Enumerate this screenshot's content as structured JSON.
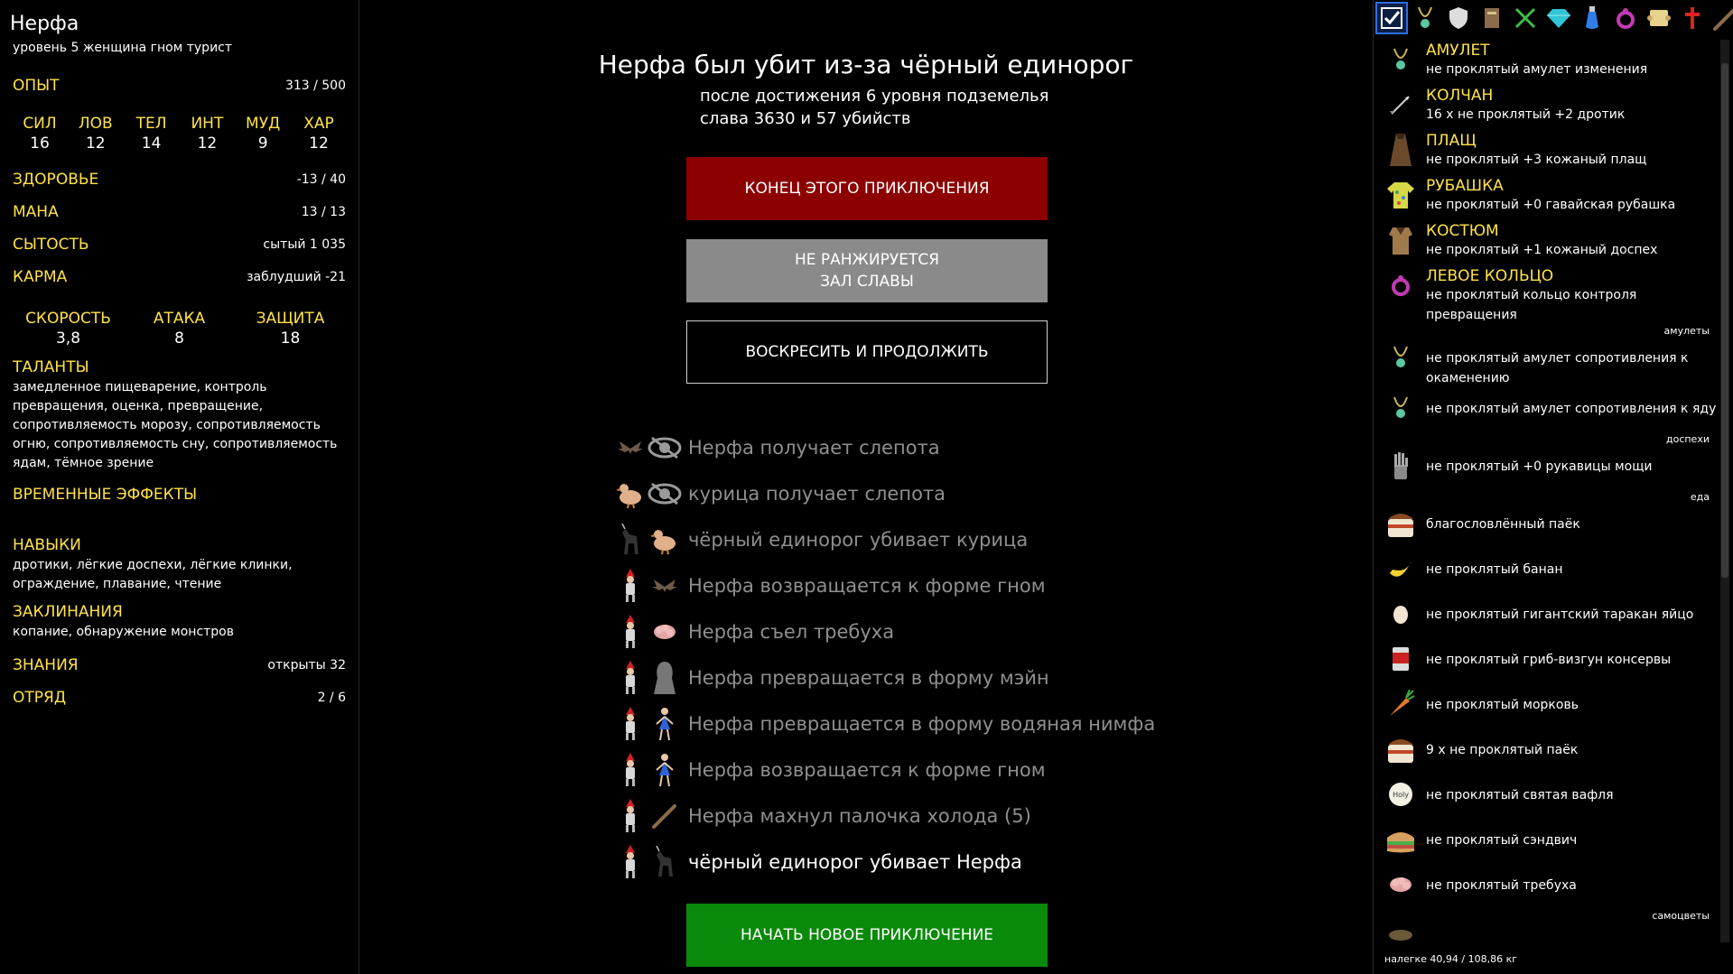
{
  "character": {
    "name": "Нерфа",
    "description": "уровень 5 женщина гном турист",
    "exp_label": "ОПЫТ",
    "exp_value": "313 / 500",
    "attributes": [
      {
        "name": "СИЛ",
        "value": "16"
      },
      {
        "name": "ЛОВ",
        "value": "12"
      },
      {
        "name": "ТЕЛ",
        "value": "14"
      },
      {
        "name": "ИНТ",
        "value": "12"
      },
      {
        "name": "МУД",
        "value": "9"
      },
      {
        "name": "ХАР",
        "value": "12"
      }
    ],
    "health_label": "ЗДОРОВЬЕ",
    "health_value": "-13 / 40",
    "mana_label": "МАНА",
    "mana_value": "13 / 13",
    "satiety_label": "СЫТОСТЬ",
    "satiety_value": "сытый 1 035",
    "karma_label": "КАРМА",
    "karma_value": "заблудший -21",
    "combat": [
      {
        "name": "СКОРОСТЬ",
        "value": "3,8"
      },
      {
        "name": "АТАКА",
        "value": "8"
      },
      {
        "name": "ЗАЩИТА",
        "value": "18"
      }
    ],
    "talents_label": "ТАЛАНТЫ",
    "talents_text": "замедленное пищеварение, контроль превращения, оценка, превращение, сопротивляемость морозу, сопротивляемость огню, сопротивляемость сну, сопротивляемость ядам, тёмное зрение",
    "effects_label": "ВРЕМЕННЫЕ ЭФФЕКТЫ",
    "skills_label": "НАВЫКИ",
    "skills_text": "дротики, лёгкие доспехи, лёгкие клинки, ограждение, плавание, чтение",
    "spells_label": "ЗАКЛИНАНИЯ",
    "spells_text": "копание, обнаружение монстров",
    "knowledge_label": "ЗНАНИЯ",
    "knowledge_value": "открыты 32",
    "party_label": "ОТРЯД",
    "party_value": "2 / 6"
  },
  "death": {
    "title": "Нерфа был убит из-за чёрный единорог",
    "line1": "после достижения 6 уровня подземелья",
    "line2": "слава 3630 и 57 убийств"
  },
  "buttons": {
    "end": "КОНЕЦ ЭТОГО ПРИКЛЮЧЕНИЯ",
    "hof_line1": "НЕ РАНЖИРУЕТСЯ",
    "hof_line2": "ЗАЛ СЛАВЫ",
    "resurrect": "ВОСКРЕСИТЬ И ПРОДОЛЖИТЬ",
    "new": "НАЧАТЬ НОВОЕ ПРИКЛЮЧЕНИЕ"
  },
  "log": [
    {
      "text": "Нерфа получает слепота",
      "actor": "bat-icon",
      "target": "blind-eye-icon"
    },
    {
      "text": "курица получает слепота",
      "actor": "chicken-icon",
      "target": "blind-eye-icon"
    },
    {
      "text": "чёрный единорог убивает курица",
      "actor": "unicorn-icon",
      "target": "chicken-icon"
    },
    {
      "text": "Нерфа возвращается к форме гном",
      "actor": "gnome-icon",
      "target": "bat-icon"
    },
    {
      "text": "Нерфа съел требуха",
      "actor": "gnome-icon",
      "target": "tripe-icon"
    },
    {
      "text": "Нерфа превращается в форму мэйн",
      "actor": "gnome-icon",
      "target": "ghost-icon"
    },
    {
      "text": "Нерфа превращается в форму водяная нимфа",
      "actor": "gnome-icon",
      "target": "nymph-icon"
    },
    {
      "text": "Нерфа возвращается к форме гном",
      "actor": "gnome-icon",
      "target": "nymph-icon"
    },
    {
      "text": "Нерфа махнул палочка холода (5)",
      "actor": "gnome-icon",
      "target": "wand-icon"
    },
    {
      "text": "чёрный единорог убивает Нерфа",
      "actor": "gnome-icon",
      "target": "unicorn-icon"
    }
  ],
  "inventory_tabs": [
    {
      "icon": "checkmark-icon",
      "selected": true
    },
    {
      "icon": "amulet-icon"
    },
    {
      "icon": "shield-icon"
    },
    {
      "icon": "book-icon"
    },
    {
      "icon": "crossed-swords-icon"
    },
    {
      "icon": "gem-icon"
    },
    {
      "icon": "potion-icon"
    },
    {
      "icon": "ring-icon"
    },
    {
      "icon": "scroll-icon"
    },
    {
      "icon": "cross-icon"
    },
    {
      "icon": "wand-icon"
    },
    {
      "icon": "sword-icon"
    }
  ],
  "equipment": [
    {
      "slot": "АМУЛЕТ",
      "desc": "не проклятый амулет изменения",
      "icon": "amulet-icon"
    },
    {
      "slot": "КОЛЧАН",
      "desc": "16 х не проклятый +2 дротик",
      "icon": "dart-icon"
    },
    {
      "slot": "ПЛАЩ",
      "desc": "не проклятый +3 кожаный плащ",
      "icon": "cloak-icon"
    },
    {
      "slot": "РУБАШКА",
      "desc": "не проклятый +0 гавайская рубашка",
      "icon": "shirt-icon"
    },
    {
      "slot": "КОСТЮМ",
      "desc": "не проклятый +1 кожаный доспех",
      "icon": "armor-icon"
    },
    {
      "slot": "ЛЕВОЕ КОЛЬЦО",
      "desc": "не проклятый кольцо контроля превращения",
      "icon": "ring-icon"
    }
  ],
  "categories": {
    "amulets": "амулеты",
    "armor": "доспехи",
    "food": "еда",
    "gems": "самоцветы"
  },
  "amulets": [
    {
      "desc": "не проклятый амулет сопротивления к окаменению",
      "icon": "amulet-icon"
    },
    {
      "desc": "не проклятый амулет сопротивления к яду",
      "icon": "amulet-icon"
    }
  ],
  "armor": [
    {
      "desc": "не проклятый +0 рукавицы мощи",
      "icon": "gauntlet-icon"
    }
  ],
  "food": [
    {
      "desc": "благословлённый паёк",
      "icon": "ration-icon"
    },
    {
      "desc": "не проклятый банан",
      "icon": "banana-icon"
    },
    {
      "desc": "не проклятый гигантский таракан яйцо",
      "icon": "egg-icon"
    },
    {
      "desc": "не проклятый гриб-визгун консервы",
      "icon": "can-icon"
    },
    {
      "desc": "не проклятый морковь",
      "icon": "carrot-icon"
    },
    {
      "desc": "9 х не проклятый паёк",
      "icon": "ration-icon"
    },
    {
      "desc": "не проклятый святая вафля",
      "icon": "wafer-icon"
    },
    {
      "desc": "не проклятый сэндвич",
      "icon": "sandwich-icon"
    },
    {
      "desc": "не проклятый требуха",
      "icon": "tripe-icon"
    }
  ],
  "wafer_label": "Holy",
  "weight": "налегке 40,94 / 108,86 кг"
}
